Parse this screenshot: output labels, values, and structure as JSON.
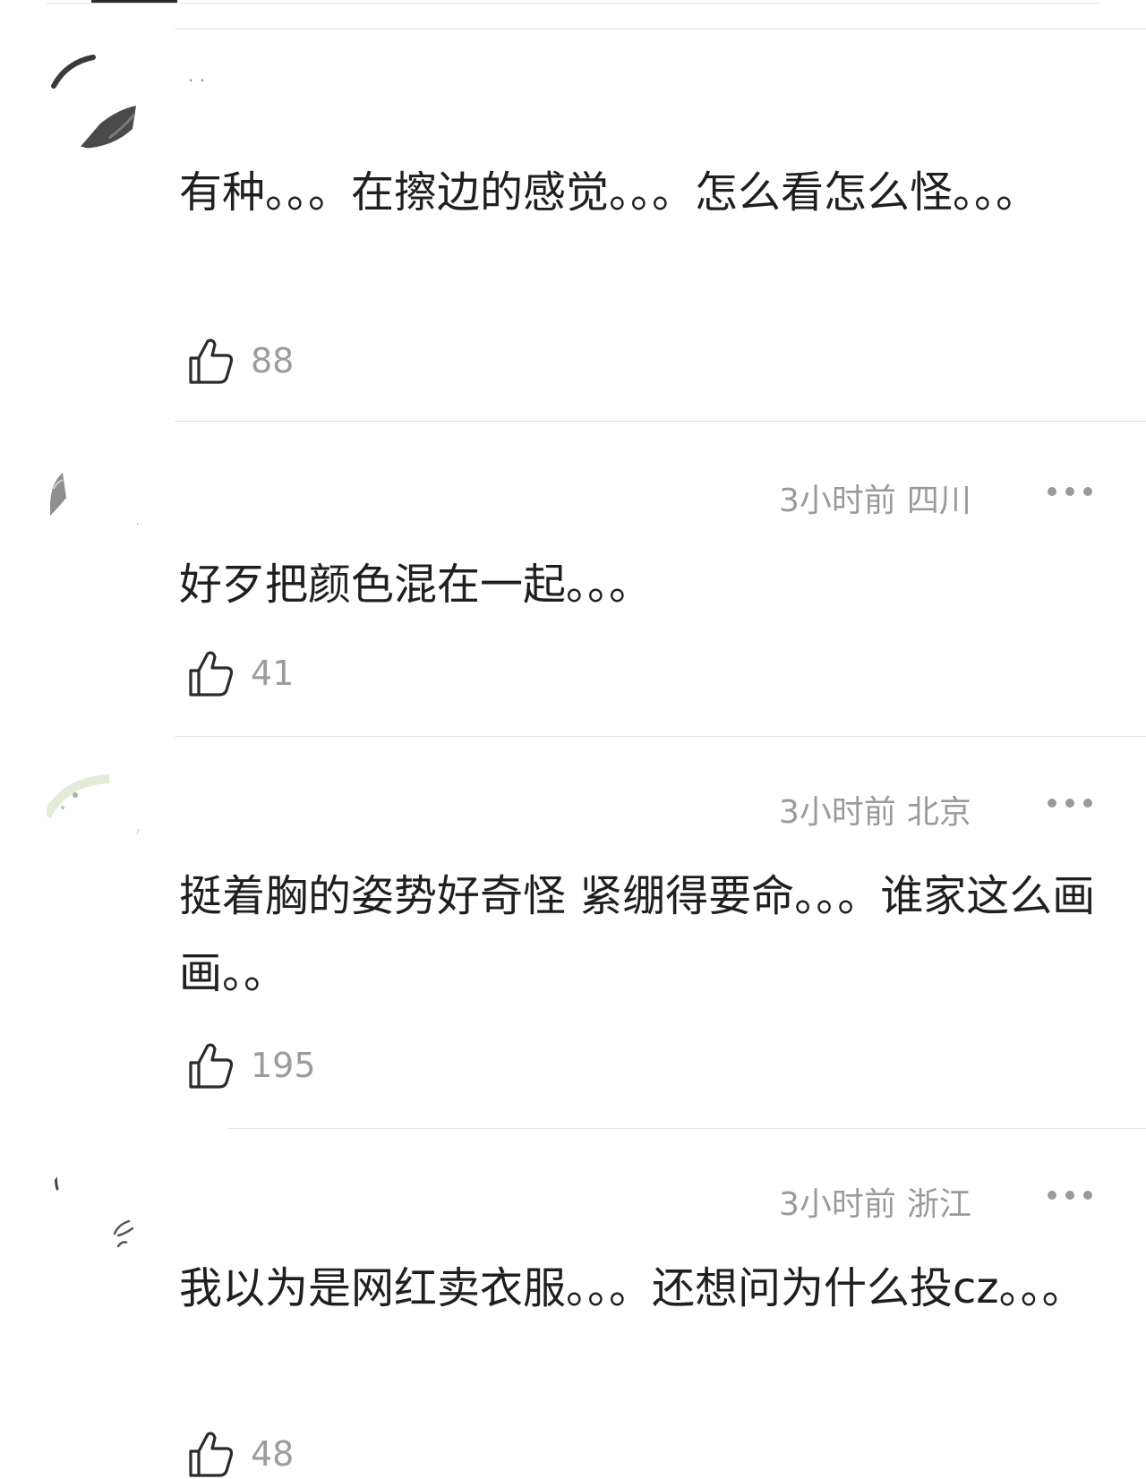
{
  "comments": [
    {
      "meta_time": "",
      "meta_region": "",
      "text": "有种。。。在擦边的感觉。。。怎么看怎么怪。。。",
      "likes": "88"
    },
    {
      "meta_time": "3小时前",
      "meta_region": "四川",
      "text": "好歹把颜色混在一起。。。",
      "likes": "41"
    },
    {
      "meta_time": "3小时前",
      "meta_region": "北京",
      "text": "挺着胸的姿势好奇怪 紧绷得要命。。。谁家这么画画。。",
      "likes": "195"
    },
    {
      "meta_time": "3小时前",
      "meta_region": "浙江",
      "text": "我以为是网红卖衣服。。。还想问为什么投cz。。。",
      "likes": "48"
    }
  ],
  "icons": {
    "like": "thumbs-up-icon",
    "more": "more-horizontal-icon",
    "avatar": "user-avatar"
  },
  "colors": {
    "meta": "#9a9a9a",
    "text": "#1f1f1f",
    "divider": "#e4e4e4"
  }
}
